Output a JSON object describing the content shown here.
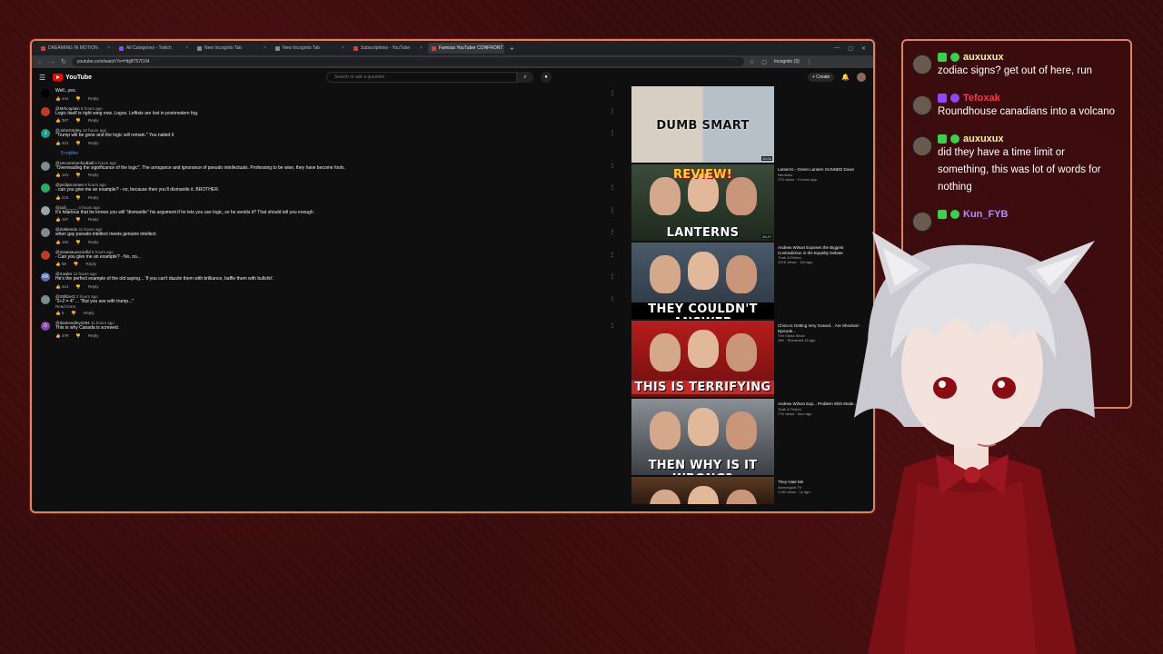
{
  "browser": {
    "tabs": [
      {
        "label": "DREAMING IN MOTION",
        "color": "#e33",
        "active": false
      },
      {
        "label": "All Categories - Twitch",
        "color": "#9146ff",
        "active": false
      },
      {
        "label": "New Incognito Tab",
        "color": "#888",
        "active": false
      },
      {
        "label": "New Incognito Tab",
        "color": "#888",
        "active": false
      },
      {
        "label": "Subscriptions - YouTube",
        "color": "#e33",
        "active": false
      },
      {
        "label": "Famous YouTuber CONFRONT",
        "color": "#e33",
        "active": true
      }
    ],
    "url": "youtube.com/watch?v=Hbj8T57O34",
    "incognito_label": "Incognito (3)"
  },
  "youtube": {
    "logo_text": "YouTube",
    "search_placeholder": "Search or ask a question",
    "create_label": "+ Create"
  },
  "comments": [
    {
      "user": "",
      "time": "",
      "text": "Well...yes.",
      "likes": "444",
      "reply": "Reply",
      "avatar_color": "#000"
    },
    {
      "user": "@Mrbcaplain",
      "time": "8 hours ago",
      "text": "Logic itself is right wing now. Logos. Leftists are lost in postmodern fog.",
      "likes": "387",
      "reply": "Reply",
      "avatar_color": "#c0392b"
    },
    {
      "user": "@JohnGripley",
      "time": "10 hours ago",
      "text": "\"Trump will be gone and the logic will remain.\" You nailed it",
      "likes": "421",
      "reply": "Reply",
      "avatar_color": "#16a085",
      "avatar_letter": "J"
    },
    {
      "user": "@Uncommonfootball",
      "time": "6 hours ago",
      "text": "\"Overreading the significance of the logic\". The arrogance and ignorance of pseudo intellectuals. Professing to be wise, they have become fools.",
      "likes": "181",
      "reply": "Reply",
      "avatar_color": "#7f8c8d"
    },
    {
      "user": "@jonlipscomee",
      "time": "8 hours ago",
      "text": "- can you give me an example? - no, because then you'll dismantle it. BROTHER.",
      "likes": "215",
      "reply": "Reply",
      "avatar_color": "#27ae60"
    },
    {
      "user": "@jodi_____",
      "time": "4 hours ago",
      "text": "It's hilarious that he knows you will \"dismantle\" his argument if he lets you use logic, so he avoids it? That should tell you enough.",
      "likes": "197",
      "reply": "Reply",
      "avatar_color": "#95a5a6"
    },
    {
      "user": "@Zekkendo",
      "time": "11 hours ago",
      "text": "when gay pseudo-intellect meets genuine intellect.",
      "likes": "182",
      "reply": "Reply",
      "avatar_color": "#7f8c8d"
    },
    {
      "user": "@meatsauceconfid",
      "time": "8 hours ago",
      "text": "- Can you give me an example? - No, no...",
      "likes": "58",
      "reply": "Reply",
      "avatar_color": "#c0392b"
    },
    {
      "user": "@rrowler",
      "time": "11 hours ago",
      "text": "He's the perfect example of the old saying... 'If you can't dazzle them with brilliance, baffle them with bullshit'.",
      "likes": "414",
      "reply": "Reply",
      "avatar_color": "#5b6abf",
      "avatar_letter": "RR"
    },
    {
      "user": "@Stillizer2",
      "time": "2 hours ago",
      "text": "\"2+2 = 4\" ... \"But you see with trump...\"",
      "likes": "6",
      "reply": "Reply",
      "avatar_color": "#7f8c8d",
      "read_more": "Read more"
    },
    {
      "user": "@dankeadley2294",
      "time": "11 hours ago",
      "text": "This is why Canada is screwed.",
      "likes": "379",
      "reply": "Reply",
      "avatar_color": "#8e44ad",
      "avatar_letter": "D"
    }
  ],
  "replies_label": "9 replies",
  "recommendations": [
    {
      "caption": "DUMB   SMART",
      "title": "",
      "channel": "",
      "meta": "",
      "duration": "10:04"
    },
    {
      "caption": "REVIEW!",
      "caption2": "LANTERNS",
      "title": "Lanterns - Green Lantern GUNNED Down",
      "channel": "Nerdrotic",
      "meta": "27K views · 2 hours ago",
      "duration": "22:27"
    },
    {
      "caption": "THEY COULDN'T ANSWER",
      "title": "Andrew Wilson Exposes the Biggest Contradiction in the Equality Debate",
      "channel": "Truth & Fiction",
      "meta": "101K views · 12d ago",
      "duration": ""
    },
    {
      "caption": "THIS IS TERRIFYING",
      "title": "China Is Getting Very Scared... Are Shocked - Episode...",
      "channel": "The China Show",
      "meta": "43K · Streamed 15 ago",
      "duration": ""
    },
    {
      "caption": "THEN WHY IS IT WRONG?",
      "title": "Andrew Wilson Exp... Problem With Mode...",
      "channel": "Truth & Fiction",
      "meta": "77K views · 3mo ago",
      "duration": ""
    },
    {
      "caption": "",
      "title": "They Hate Me",
      "channel": "Asmongold TV",
      "meta": "1.1M views · 1y ago",
      "duration": ""
    }
  ],
  "chat": [
    {
      "user": "auxuxux",
      "user_color": "#f5f5a0",
      "badge1": "#3ad14a",
      "badge2": "#3ad14a",
      "text": "zodiac signs? get out of here, run"
    },
    {
      "user": "Tefoxak",
      "user_color": "#ff3344",
      "badge1": "#9146ff",
      "badge2": "#9146ff",
      "text": "Roundhouse canadians into a volcano"
    },
    {
      "user": "auxuxux",
      "user_color": "#f5f5a0",
      "badge1": "#3ad14a",
      "badge2": "#3ad14a",
      "text": "did they have a time limit or something, this was lot of words for nothing"
    },
    {
      "user": "Kun_FYB",
      "user_color": "#b08cff",
      "badge1": "#3ad14a",
      "badge2": "#3ad14a",
      "text": ""
    }
  ]
}
